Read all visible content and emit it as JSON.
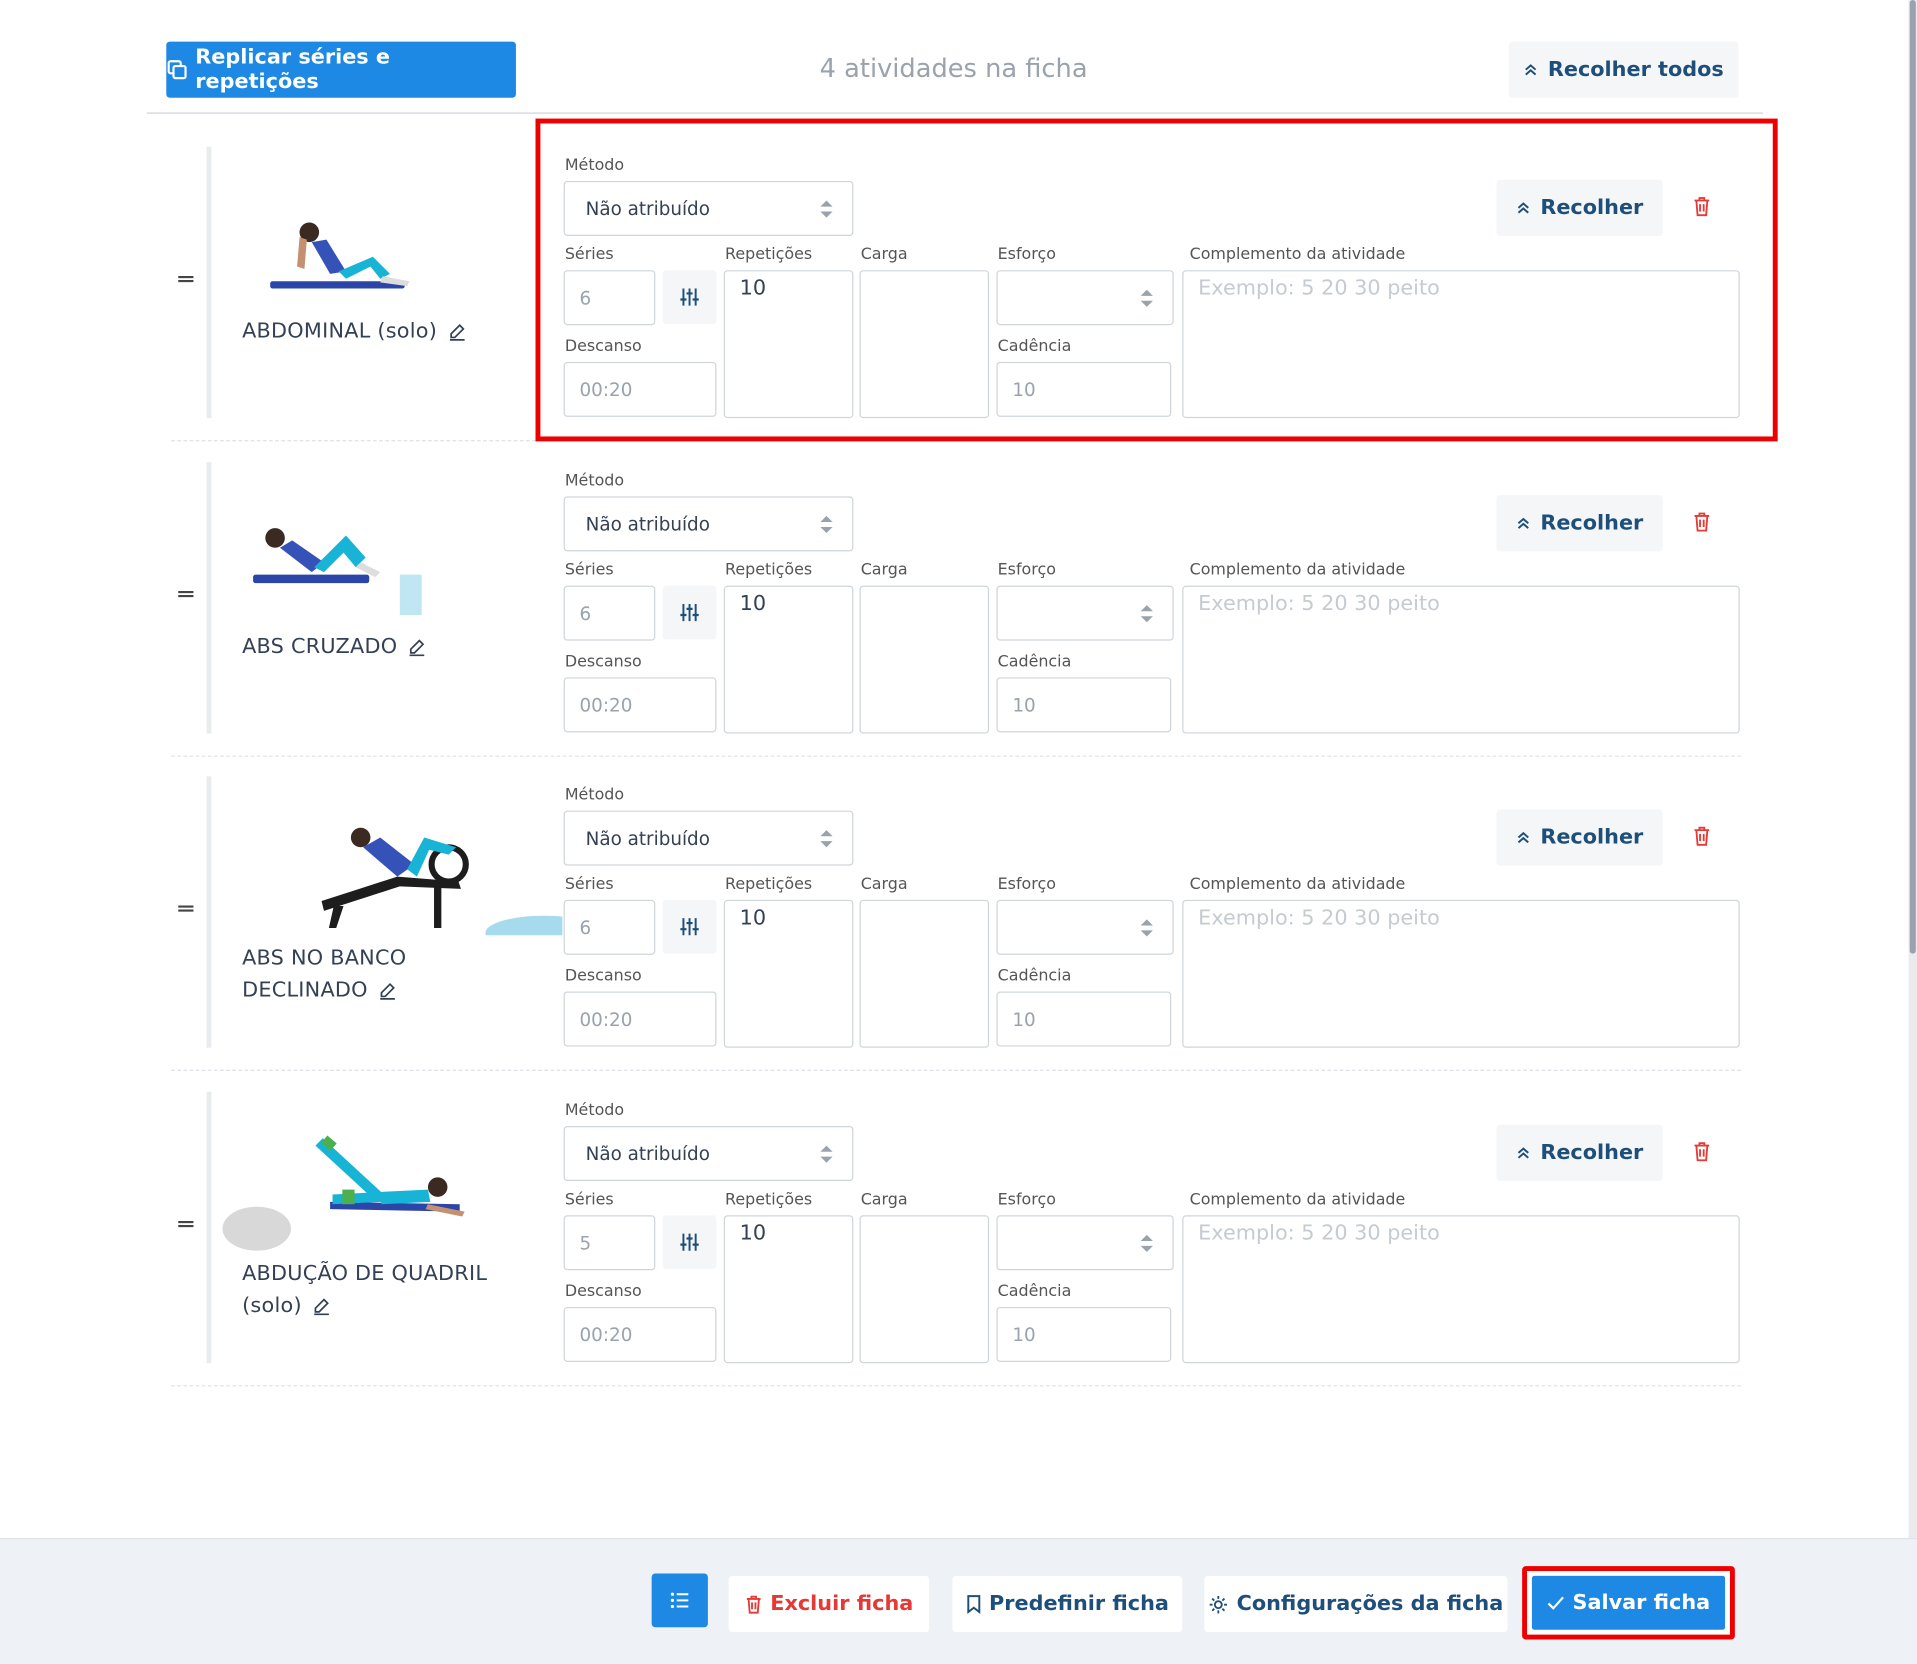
{
  "header": {
    "replicate_button": "Replicar séries e repetições",
    "activity_count": "4 atividades na ficha",
    "collapse_all_button": "Recolher todos"
  },
  "labels": {
    "method": "Método",
    "sets": "Séries",
    "reps": "Repetições",
    "load": "Carga",
    "effort": "Esforço",
    "complement": "Complemento da atividade",
    "rest": "Descanso",
    "cadence": "Cadência",
    "collapse": "Recolher"
  },
  "activities": [
    {
      "name": "ABDOMINAL (solo)",
      "method": "Não atribuído",
      "sets": "6",
      "reps": "10",
      "load": "",
      "effort": "",
      "rest": "00:20",
      "cadence": "10",
      "complement_placeholder": "Exemplo: 5 20 30 peito",
      "icon": "abdominal-floor-image"
    },
    {
      "name": "ABS CRUZADO",
      "method": "Não atribuído",
      "sets": "6",
      "reps": "10",
      "load": "",
      "effort": "",
      "rest": "00:20",
      "cadence": "10",
      "complement_placeholder": "Exemplo: 5 20 30 peito",
      "icon": "cross-crunch-image"
    },
    {
      "name": "ABS NO BANCO DECLINADO",
      "method": "Não atribuído",
      "sets": "6",
      "reps": "10",
      "load": "",
      "effort": "",
      "rest": "00:20",
      "cadence": "10",
      "complement_placeholder": "Exemplo: 5 20 30 peito",
      "icon": "decline-bench-image"
    },
    {
      "name": "ABDUÇÃO DE QUADRIL (solo)",
      "method": "Não atribuído",
      "sets": "5",
      "reps": "10",
      "load": "",
      "effort": "",
      "rest": "00:20",
      "cadence": "10",
      "complement_placeholder": "Exemplo: 5 20 30 peito",
      "icon": "hip-abduction-image"
    }
  ],
  "footer": {
    "delete_button": "Excluir ficha",
    "preset_button": "Predefinir ficha",
    "settings_button": "Configurações da ficha",
    "save_button": "Salvar ficha"
  },
  "colors": {
    "primary": "#1e88e5",
    "danger": "#e53935",
    "highlight": "#ee0000",
    "secondary_text": "#1e4f7a"
  }
}
